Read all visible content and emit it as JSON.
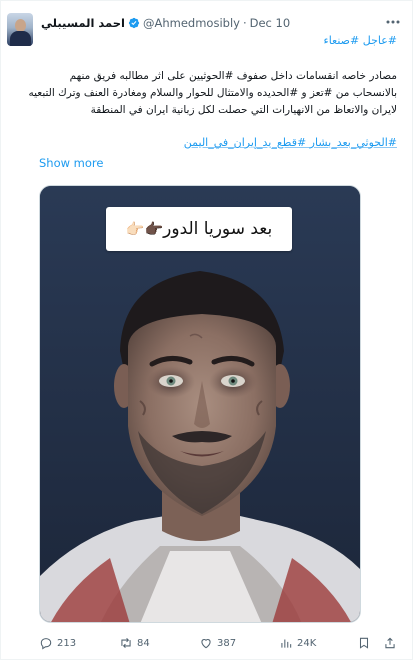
{
  "author": {
    "display_name": "احمد المسيبلي",
    "handle": "@Ahmedmosibly",
    "separator": "·",
    "date": "Dec 10"
  },
  "tweet": {
    "tags_line": "#عاجل #صنعاء",
    "body_line1": "مصادر خاصه انقسامات داخل صفوف  #الحوثيين على اثر مطالبه فريق منهم",
    "body_line2": "بالانسحاب من #تعز و #الحديده والامتثال للحوار والسلام ومغادرة العنف وترك التبعيه",
    "body_line3": "لايران والاتعاظ من الانهيارات  التي حصلت لكل زبانية ايران في المنطقة",
    "hashtags_line": "#الحوثي_بعد_بشار #قطع_يد_إيران_في_اليمن",
    "show_more": "Show more",
    "image_caption": "بعد سوريا الدور",
    "image_caption_emoji": "👉🏿👉🏻"
  },
  "actions": {
    "replies": "213",
    "reposts": "84",
    "likes": "387",
    "views": "24K"
  },
  "icons": {
    "avatar": "avatar",
    "verified": "verified-badge-icon",
    "more": "more-dots-icon",
    "reply": "reply-icon",
    "repost": "repost-icon",
    "like": "heart-icon",
    "views": "views-chart-icon",
    "bookmark": "bookmark-icon",
    "share": "share-icon"
  },
  "colors": {
    "accent": "#1d9bf0",
    "secondary_text": "#536471",
    "text": "#0f1419"
  }
}
